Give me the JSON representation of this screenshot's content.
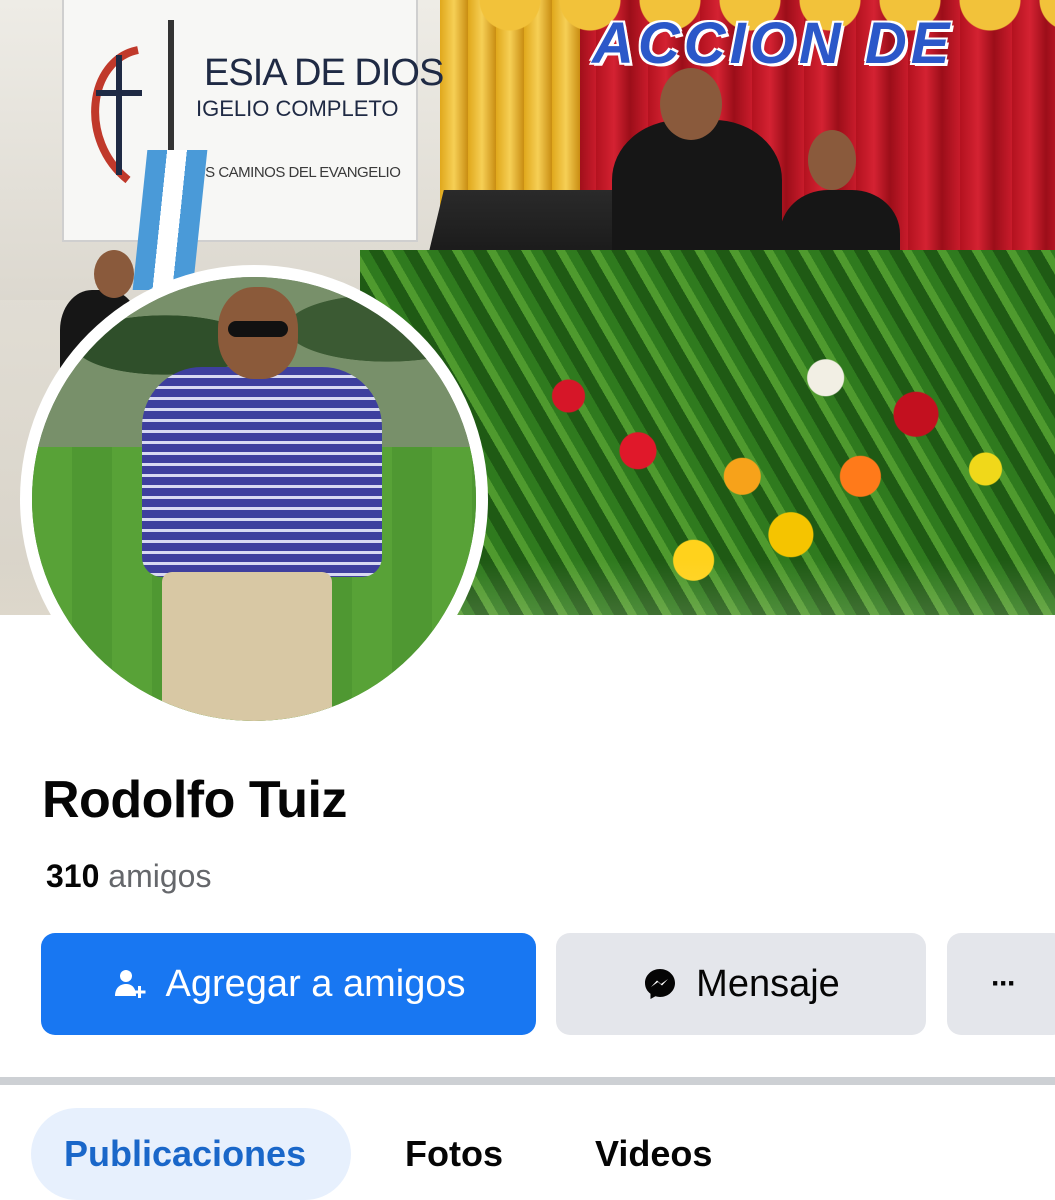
{
  "cover": {
    "banner_line1": "ESIA DE DIOS",
    "banner_line2": "IGELIO COMPLETO",
    "banner_line3": "OS CAMINOS DEL EVANGELIO",
    "sign_text": "ACCION DE"
  },
  "profile": {
    "name": "Rodolfo Tuiz",
    "friends_count": "310",
    "friends_label": "amigos"
  },
  "actions": {
    "add_friend_label": "Agregar a amigos",
    "message_label": "Mensaje",
    "more_label": "···"
  },
  "tabs": [
    {
      "label": "Publicaciones",
      "selected": true
    },
    {
      "label": "Fotos",
      "selected": false
    },
    {
      "label": "Videos",
      "selected": false
    }
  ],
  "colors": {
    "primary_button": "#1877f2",
    "secondary_button": "#e4e6eb",
    "selected_tab_bg": "#e7f0fd",
    "selected_tab_text": "#1a67c9"
  },
  "icons": {
    "add_friend": "add-person-icon",
    "message": "messenger-icon",
    "more": "more-dots-icon"
  }
}
